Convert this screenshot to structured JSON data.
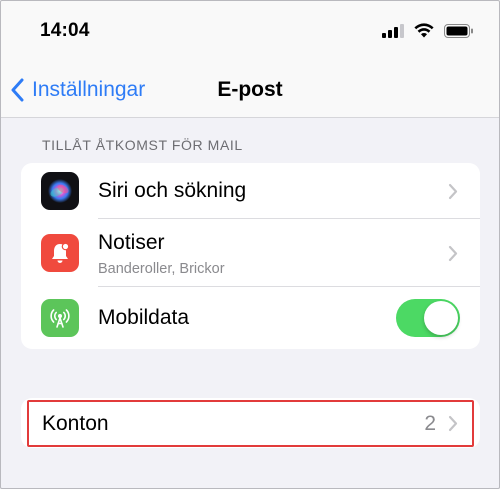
{
  "status_bar": {
    "time": "14:04",
    "icons": [
      "cellular-signal-icon",
      "wifi-icon",
      "battery-icon"
    ]
  },
  "nav": {
    "back_label": "Inställningar",
    "title": "E-post"
  },
  "section": {
    "header": "TILLÅT ÅTKOMST FÖR MAIL",
    "rows": [
      {
        "title": "Siri och sökning",
        "icon": "siri-icon"
      },
      {
        "title": "Notiser",
        "subtitle": "Banderoller, Brickor",
        "icon": "bell-icon"
      },
      {
        "title": "Mobildata",
        "icon": "antenna-icon",
        "toggle_on": true
      }
    ]
  },
  "accounts": {
    "title": "Konton",
    "value": "2"
  },
  "colors": {
    "accent": "#2e7cf6",
    "toggle_on": "#4cd964",
    "notification_red": "#f04a3e",
    "cellular_green": "#5cc55a",
    "highlight_red": "#e23b3b"
  }
}
